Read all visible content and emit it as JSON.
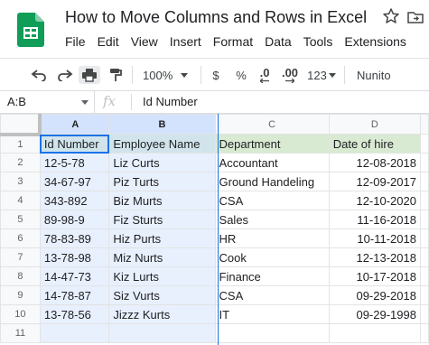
{
  "doc": {
    "title": "How to Move Columns and Rows in Excel"
  },
  "menu": [
    "File",
    "Edit",
    "View",
    "Insert",
    "Format",
    "Data",
    "Tools",
    "Extensions"
  ],
  "toolbar": {
    "zoom": "100%",
    "currency": "$",
    "percent": "%",
    "dec_decrease": ".0",
    "dec_increase": ".00",
    "more_formats": "123",
    "font": "Nunito"
  },
  "formula_bar": {
    "name_box": "A:B",
    "fx": "fx",
    "value": "Id Number"
  },
  "grid": {
    "columns": [
      "A",
      "B",
      "C",
      "D"
    ],
    "selected_columns": [
      "A",
      "B"
    ],
    "row_numbers": [
      "1",
      "2",
      "3",
      "4",
      "5",
      "6",
      "7",
      "8",
      "9",
      "10",
      "11"
    ],
    "header": [
      "Id Number",
      "Employee Name",
      "Department",
      "Date of hire"
    ],
    "rows": [
      [
        "12-5-78",
        "Liz Curts",
        "Accountant",
        "12-08-2018"
      ],
      [
        "34-67-97",
        "Piz Turts",
        "Ground Handeling",
        "12-09-2017"
      ],
      [
        "343-892",
        "Biz Murts",
        "CSA",
        "12-10-2020"
      ],
      [
        "89-98-9",
        "Fiz Sturts",
        "Sales",
        "11-16-2018"
      ],
      [
        "78-83-89",
        "Hiz Purts",
        "HR",
        "10-11-2018"
      ],
      [
        "13-78-98",
        "Miz Nurts",
        "Cook",
        "12-13-2018"
      ],
      [
        "14-47-73",
        "Kiz Lurts",
        "Finance",
        "10-17-2018"
      ],
      [
        "14-78-87",
        "Siz Vurts",
        "CSA",
        "09-29-2018"
      ],
      [
        "13-78-56",
        "Jizzz Kurts",
        "IT",
        "09-29-1998"
      ]
    ]
  },
  "colors": {
    "header_fill": "#d9ead3",
    "selection_fill": "#e8f0fe",
    "selection_accent": "#1a73e8",
    "logo_green": "#0f9d58"
  }
}
